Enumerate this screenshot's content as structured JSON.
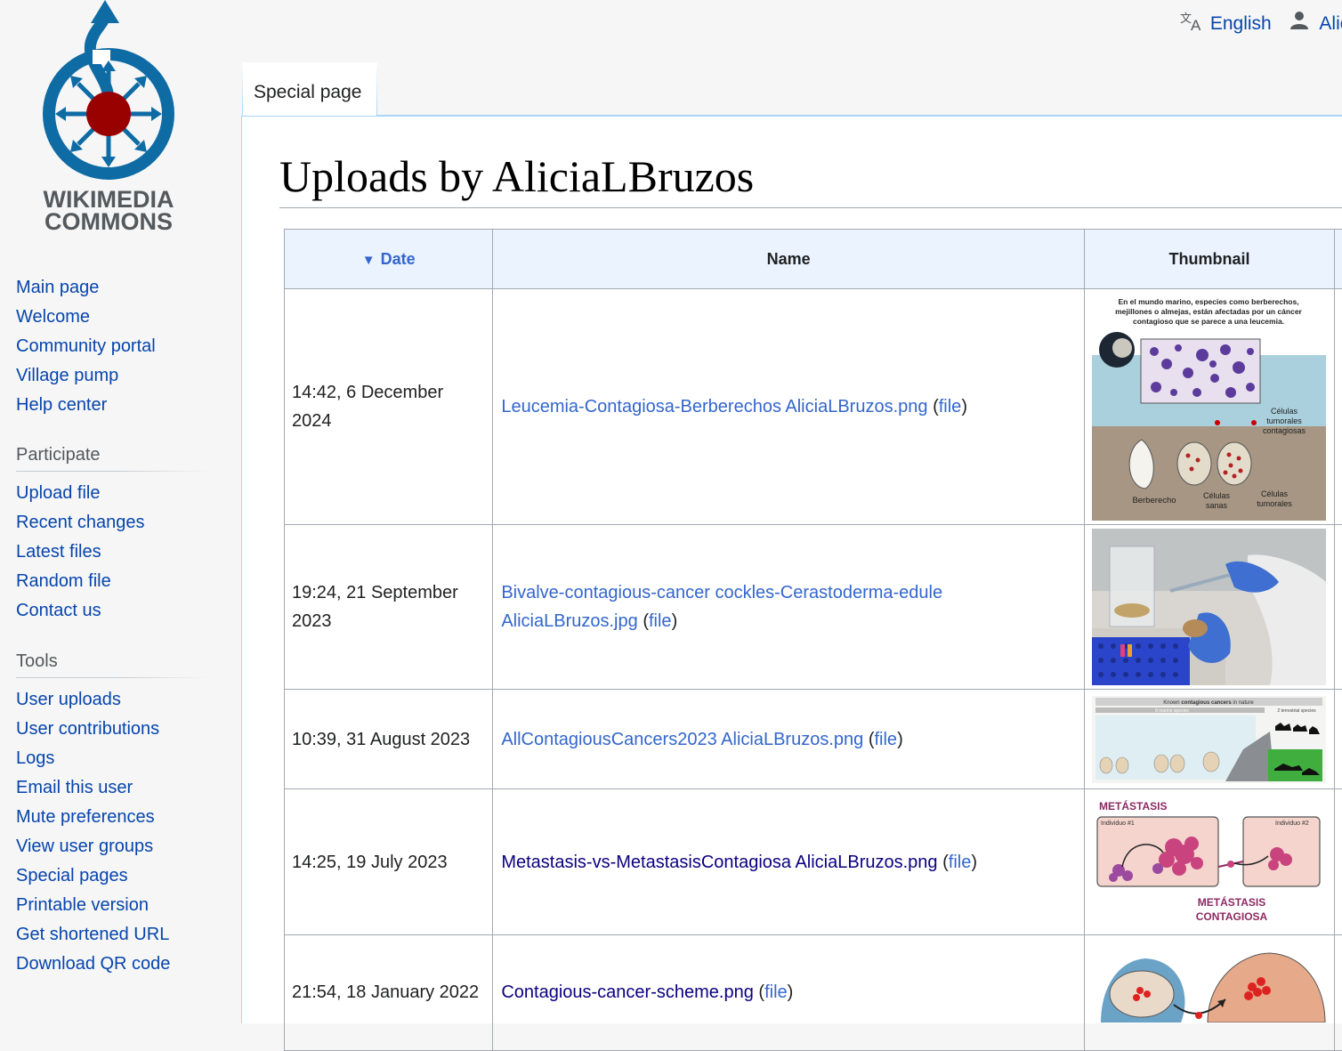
{
  "site": {
    "logo_text_line1": "WIKIMEDIA",
    "logo_text_line2": "COMMONS"
  },
  "personal": {
    "language": "English",
    "user": "Alici"
  },
  "tabs": [
    {
      "label": "Special page"
    }
  ],
  "sidebar": {
    "navigation": [
      {
        "label": "Main page"
      },
      {
        "label": "Welcome"
      },
      {
        "label": "Community portal"
      },
      {
        "label": "Village pump"
      },
      {
        "label": "Help center"
      }
    ],
    "participate": {
      "heading": "Participate",
      "items": [
        {
          "label": "Upload file"
        },
        {
          "label": "Recent changes"
        },
        {
          "label": "Latest files"
        },
        {
          "label": "Random file"
        },
        {
          "label": "Contact us"
        }
      ]
    },
    "tools": {
      "heading": "Tools",
      "items": [
        {
          "label": "User uploads"
        },
        {
          "label": "User contributions"
        },
        {
          "label": "Logs"
        },
        {
          "label": "Email this user"
        },
        {
          "label": "Mute preferences"
        },
        {
          "label": "View user groups"
        },
        {
          "label": "Special pages"
        },
        {
          "label": "Printable version"
        },
        {
          "label": "Get shortened URL"
        },
        {
          "label": "Download QR code"
        }
      ]
    }
  },
  "page": {
    "title": "Uploads by AliciaLBruzos"
  },
  "table": {
    "columns": {
      "date": "Date",
      "name": "Name",
      "thumbnail": "Thumbnail"
    },
    "file_link": "file",
    "rows": [
      {
        "date_line1": "14:42, 6 December",
        "date_line2": "2024",
        "name_line1": "Leucemia-Contagiosa-Berberechos AliciaLBruzos.png",
        "name_line2": "",
        "thumb": {
          "title": "En el mundo marino, especies como berberechos, mejillones o almejas, están afectadas por un cáncer contagioso que se parece a una leucemia.",
          "label_berberecho": "Berberecho",
          "label_sanas_1": "Células",
          "label_sanas_2": "sanas",
          "label_tumor_1": "Células",
          "label_tumor_2": "tumorales",
          "label_contag_1": "Células",
          "label_contag_2": "tumorales",
          "label_contag_3": "contagiosas"
        }
      },
      {
        "date_line1": "19:24, 21 September",
        "date_line2": "2023",
        "name_line1": "Bivalve-contagious-cancer cockles-Cerastoderma-edule",
        "name_line2": "AliciaLBruzos.jpg"
      },
      {
        "date_line1": "10:39, 31 August 2023",
        "date_line2": "",
        "name_line1": "AllContagiousCancers2023 AliciaLBruzos.png",
        "name_line2": "",
        "thumb": {
          "top_label_1": "Known",
          "top_label_2": "contagious cancers",
          "top_label_3": "in nature",
          "left_label": "8 marine species",
          "right_label": "2 terrestrial species"
        }
      },
      {
        "date_line1": "14:25, 19 July 2023",
        "date_line2": "",
        "name_line1": "Metastasis-vs-MetastasisContagiosa AliciaLBruzos.png",
        "name_line2": "",
        "thumb": {
          "title": "METÁSTASIS",
          "box1": "Individuo #1",
          "box2": "Individuo #2",
          "bottom_1": "METÁSTASIS",
          "bottom_2": "CONTAGIOSA"
        }
      },
      {
        "date_line1": "21:54, 18 January 2022",
        "date_line2": "",
        "name_line1": "Contagious-cancer-scheme.png",
        "name_line2": ""
      }
    ]
  },
  "colors": {
    "link": "#3366cc",
    "link_visited": "#0b0080",
    "logo_blue": "#0f6ba4",
    "logo_red": "#990000"
  }
}
